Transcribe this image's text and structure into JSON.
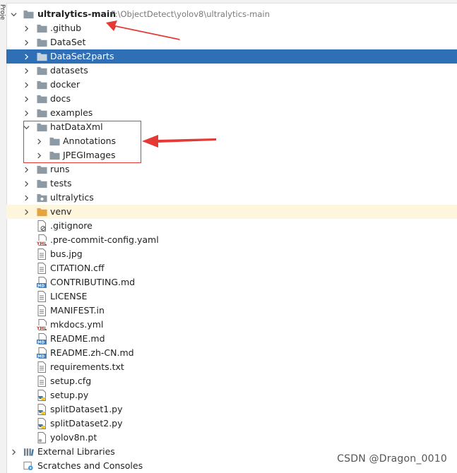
{
  "side_panel": {
    "vertical_label": "Proje"
  },
  "root": {
    "name": "ultralytics-main",
    "path": "F:\\ObjectDetect\\yolov8\\ultralytics-main"
  },
  "items": {
    "github": ".github",
    "dataset": "DataSet",
    "dataset2parts": "DataSet2parts",
    "datasets": "datasets",
    "docker": "docker",
    "docs": "docs",
    "examples": "examples",
    "hatdataxml": "hatDataXml",
    "annotations": "Annotations",
    "jpegimages": "JPEGImages",
    "runs": "runs",
    "tests": "tests",
    "ultralytics": "ultralytics",
    "venv": "venv",
    "gitignore": ".gitignore",
    "precommit": ".pre-commit-config.yaml",
    "busjpg": "bus.jpg",
    "citation": "CITATION.cff",
    "contributing": "CONTRIBUTING.md",
    "license": "LICENSE",
    "manifest": "MANIFEST.in",
    "mkdocs": "mkdocs.yml",
    "readme": "README.md",
    "readme_zh": "README.zh-CN.md",
    "requirements": "requirements.txt",
    "setupcfg": "setup.cfg",
    "setuppy": "setup.py",
    "split1": "splitDataset1.py",
    "split2": "splitDataset2.py",
    "yolov8n": "yolov8n.pt",
    "external_libraries": "External Libraries",
    "scratches": "Scratches and Consoles"
  },
  "icons": {
    "folder": "folder-icon",
    "file": "file-icon",
    "yaml": "yaml-icon",
    "markdown": "markdown-icon",
    "python": "python-icon",
    "library": "library-icon",
    "scratches": "scratches-icon"
  },
  "colors": {
    "selection": "#2f6fb5",
    "folder": "#8c9aa6",
    "venv_folder": "#e8a33d",
    "annotation_red": "#e53935"
  },
  "watermark": "CSDN @Dragon_0010"
}
